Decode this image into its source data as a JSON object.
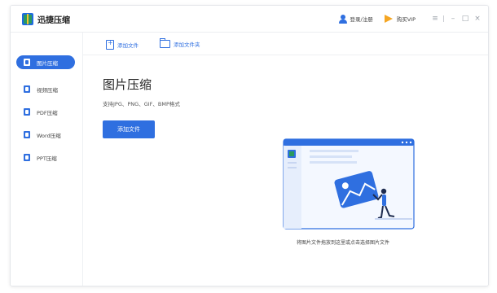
{
  "app": {
    "title": "迅捷压缩"
  },
  "titlebar": {
    "login_label": "登录/注册",
    "vip_label": "购买VIP",
    "menu_icon": "menu-icon",
    "minimize_icon": "minimize-icon",
    "maximize_icon": "maximize-icon",
    "close_icon": "close-icon"
  },
  "sidebar": {
    "items": [
      {
        "label": "图片压缩",
        "icon": "image-compress-icon",
        "active": true
      },
      {
        "label": "视频压缩",
        "icon": "video-compress-icon",
        "active": false
      },
      {
        "label": "PDF压缩",
        "icon": "pdf-compress-icon",
        "active": false
      },
      {
        "label": "Word压缩",
        "icon": "word-compress-icon",
        "active": false
      },
      {
        "label": "PPT压缩",
        "icon": "ppt-compress-icon",
        "active": false
      }
    ]
  },
  "toolbar": {
    "add_file_label": "添加文件",
    "add_folder_label": "添加文件夹"
  },
  "main": {
    "title": "图片压缩",
    "subtitle": "支持JPG、PNG、GIF、BMP格式",
    "add_file_button": "添加文件",
    "drop_hint": "将图片文件拖放到这里或点击选择图片文件"
  },
  "colors": {
    "accent": "#2f6fe0",
    "vip": "#f5a623",
    "border": "#e4e6ea"
  }
}
